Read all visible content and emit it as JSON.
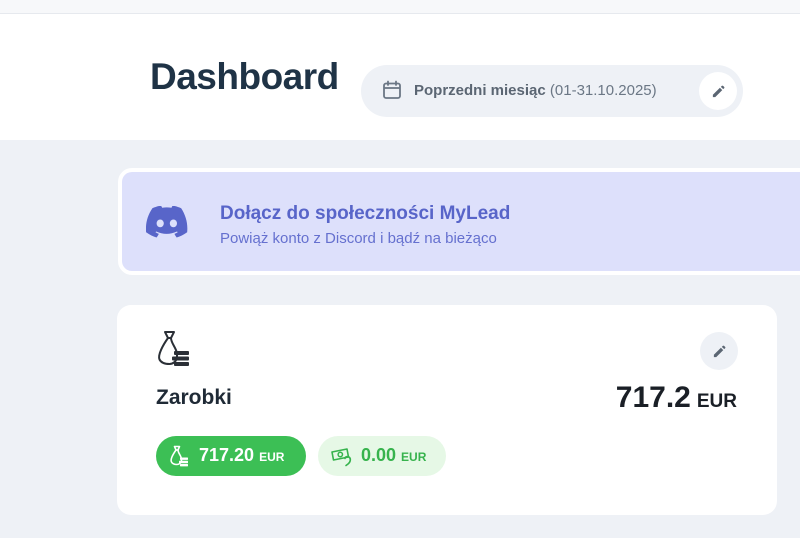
{
  "header": {
    "title": "Dashboard",
    "period": {
      "label": "Poprzedni miesiąc",
      "range": "(01-31.10.2025)",
      "icon": "calendar-icon",
      "edit_icon": "pencil-icon"
    }
  },
  "discord": {
    "title": "Dołącz do społeczności MyLead",
    "subtitle": "Powiąż konto z Discord i bądź na bieżąco",
    "icon": "discord-icon",
    "color": "#5865c9"
  },
  "earnings": {
    "label": "Zarobki",
    "total_value": "717.2",
    "total_currency": "EUR",
    "icon": "money-bag-icon",
    "edit_icon": "pencil-icon",
    "pills": [
      {
        "value": "717.20",
        "currency": "EUR",
        "icon": "money-bag-icon",
        "color": "#3cbf55"
      },
      {
        "value": "0.00",
        "currency": "EUR",
        "icon": "cash-icon",
        "color": "#37b34d"
      }
    ]
  }
}
